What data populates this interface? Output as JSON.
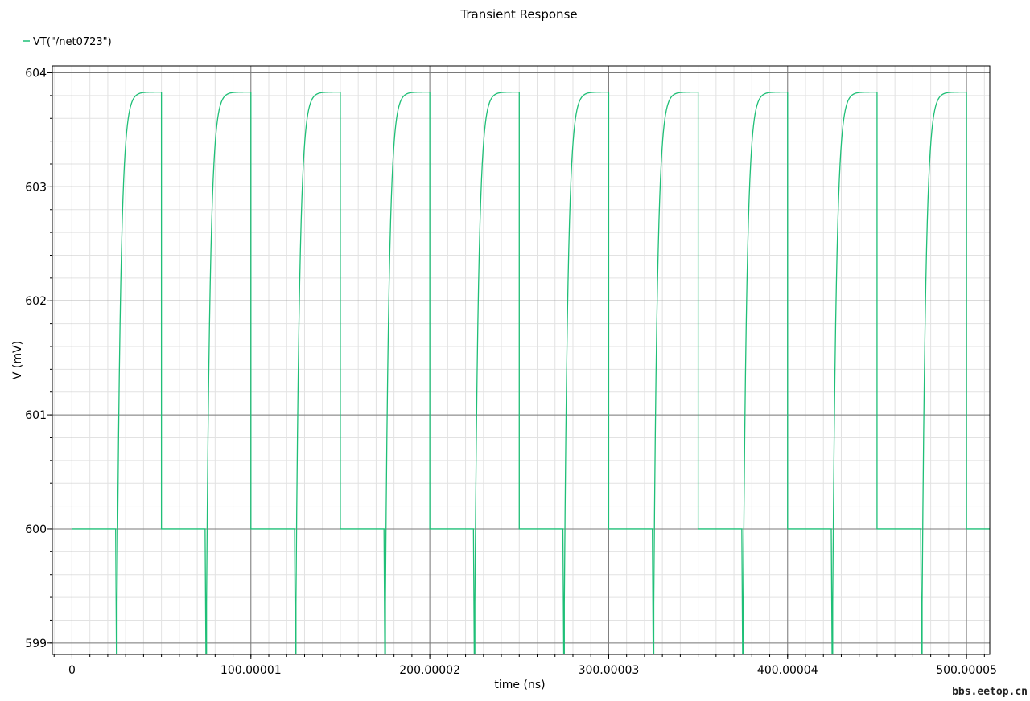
{
  "chart_data": {
    "type": "line",
    "title": "Transient Response",
    "xlabel": "time (ns)",
    "ylabel": "V (mV)",
    "xlim": [
      -11,
      513
    ],
    "ylim": [
      598.9,
      604.06
    ],
    "x_ticks": [
      {
        "value": 0,
        "label": "0"
      },
      {
        "value": 100.00001,
        "label": "100.00001"
      },
      {
        "value": 200.00002,
        "label": "200.00002"
      },
      {
        "value": 300.00003,
        "label": "300.00003"
      },
      {
        "value": 400.00004,
        "label": "400.00004"
      },
      {
        "value": 500.00005,
        "label": "500.00005"
      }
    ],
    "y_ticks": [
      {
        "value": 599,
        "label": "599"
      },
      {
        "value": 600,
        "label": "600"
      },
      {
        "value": 601,
        "label": "601"
      },
      {
        "value": 602,
        "label": "602"
      },
      {
        "value": 603,
        "label": "603"
      },
      {
        "value": 604,
        "label": "604"
      }
    ],
    "grid": true,
    "legend_position": "top-left",
    "series": [
      {
        "name": "VT(\"/net0723\")",
        "color": "#1fbf77",
        "waveform": {
          "period_ns": 50,
          "pulse_count": 10,
          "baseline_mv": 600,
          "high_mv": 603.83,
          "min_dip_mv": 598.9,
          "rise_start_offset_ns": 25,
          "fall_offset_ns": 50
        }
      }
    ]
  },
  "watermark": "bbs.eetop.cn"
}
